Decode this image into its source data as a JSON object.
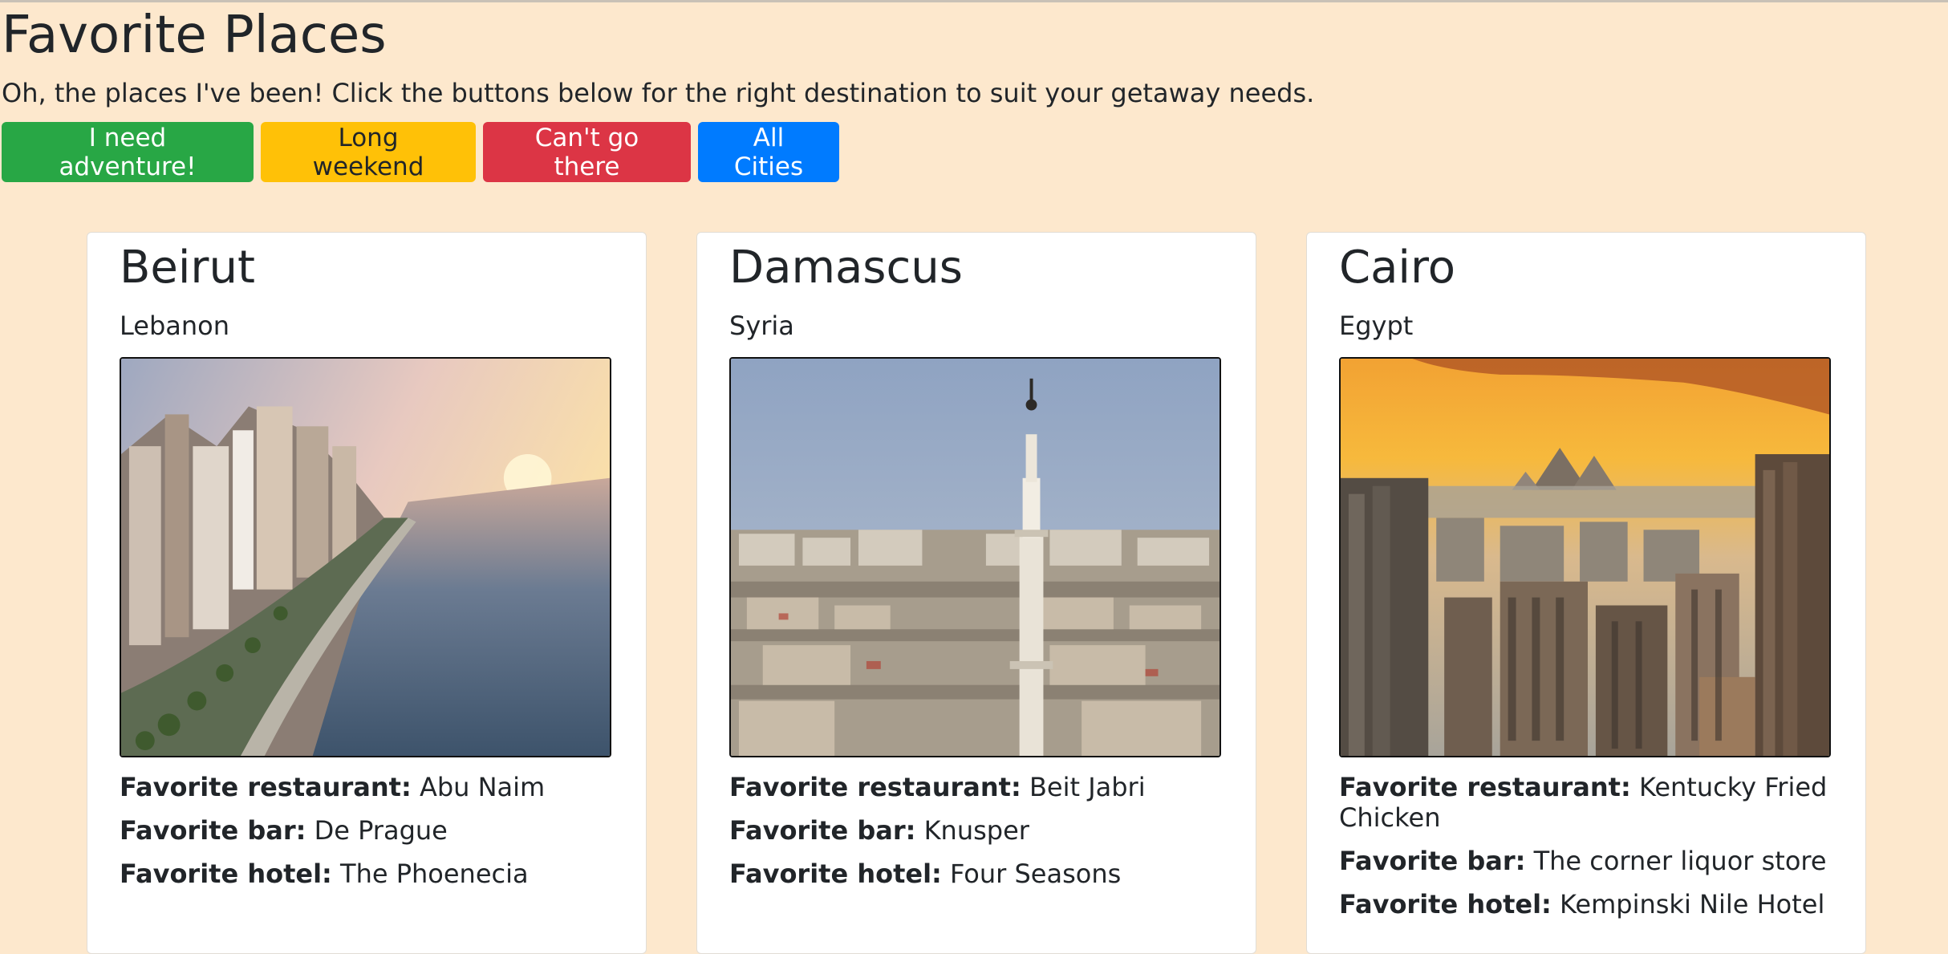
{
  "page": {
    "title": "Favorite Places",
    "intro": "Oh, the places I've been! Click the buttons below for the right destination to suit your getaway needs."
  },
  "filters": [
    {
      "label": "I need adventure!",
      "color": "#28a745"
    },
    {
      "label": "Long weekend",
      "color": "#ffc107"
    },
    {
      "label": "Can't go there",
      "color": "#dc3545"
    },
    {
      "label": "All Cities",
      "color": "#007bff"
    }
  ],
  "labels": {
    "restaurant": "Favorite restaurant:",
    "bar": "Favorite bar:",
    "hotel": "Favorite hotel:"
  },
  "cities": [
    {
      "name": "Beirut",
      "country": "Lebanon",
      "restaurant": "Abu Naim",
      "bar": "De Prague",
      "hotel": "The Phoenecia"
    },
    {
      "name": "Damascus",
      "country": "Syria",
      "restaurant": "Beit Jabri",
      "bar": "Knusper",
      "hotel": "Four Seasons"
    },
    {
      "name": "Cairo",
      "country": "Egypt",
      "restaurant": "Kentucky Fried Chicken",
      "bar": "The corner liquor store",
      "hotel": "Kempinski Nile Hotel"
    }
  ]
}
